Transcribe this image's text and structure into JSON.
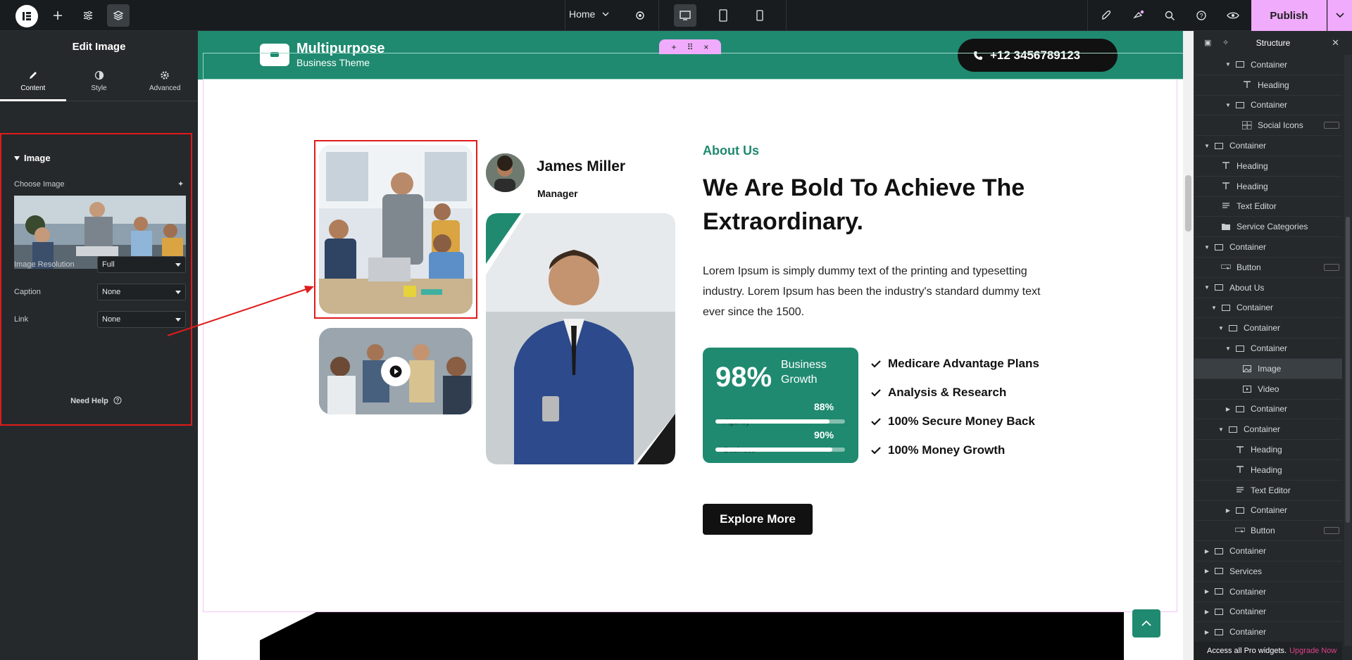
{
  "topbar": {
    "page_name": "Home",
    "publish_label": "Publish"
  },
  "left_panel": {
    "title": "Edit Image",
    "tabs": [
      {
        "label": "Content",
        "icon": "pencil-icon"
      },
      {
        "label": "Style",
        "icon": "contrast-icon"
      },
      {
        "label": "Advanced",
        "icon": "gear-icon"
      }
    ],
    "section_title": "Image",
    "choose_image_label": "Choose Image",
    "fields": [
      {
        "label": "Image Resolution",
        "value": "Full"
      },
      {
        "label": "Caption",
        "value": "None"
      },
      {
        "label": "Link",
        "value": "None"
      }
    ],
    "need_help": "Need Help"
  },
  "site": {
    "brand_name": "Multipurpose",
    "brand_tagline": "Business Theme",
    "phone": "+12 3456789123",
    "person_name": "James Miller",
    "person_role": "Manager",
    "about_eyebrow": "About Us",
    "about_title": "We Are Bold To Achieve The Extraordinary.",
    "about_body": "Lorem Ipsum is simply dummy text of the printing and typesetting industry. Lorem Ipsum has been the industry's standard dummy text ever since the 1500.",
    "stat_value": "98%",
    "stat_label": "Business Growth",
    "bars": [
      {
        "name": "Agency",
        "value": "88%",
        "fraction": 0.88
      },
      {
        "name": "Business",
        "value": "90%",
        "fraction": 0.9
      }
    ],
    "checklist": [
      "Medicare Advantage Plans",
      "Analysis & Research",
      "100% Secure Money Back",
      "100% Money Growth"
    ],
    "explore_label": "Explore More",
    "accent_color": "#1f8a70"
  },
  "structure": {
    "title": "Structure",
    "items": [
      {
        "label": "Container",
        "depth": 3,
        "caret": "down",
        "icon": "container-icon"
      },
      {
        "label": "Heading",
        "depth": 4,
        "caret": "",
        "icon": "heading-icon"
      },
      {
        "label": "Container",
        "depth": 3,
        "caret": "down",
        "icon": "container-icon"
      },
      {
        "label": "Social Icons",
        "depth": 4,
        "caret": "",
        "icon": "social-icons-icon"
      },
      {
        "label": "Container",
        "depth": 0,
        "caret": "down",
        "icon": "container-icon"
      },
      {
        "label": "Heading",
        "depth": 1,
        "caret": "",
        "icon": "heading-icon"
      },
      {
        "label": "Heading",
        "depth": 1,
        "caret": "",
        "icon": "heading-icon"
      },
      {
        "label": "Text Editor",
        "depth": 1,
        "caret": "",
        "icon": "text-editor-icon"
      },
      {
        "label": "Service Categories",
        "depth": 1,
        "caret": "",
        "icon": "folder-icon"
      },
      {
        "label": "Container",
        "depth": 0,
        "caret": "down",
        "icon": "container-icon"
      },
      {
        "label": "Button",
        "depth": 1,
        "caret": "",
        "icon": "button-icon"
      },
      {
        "label": "About Us",
        "depth": 0,
        "caret": "down",
        "icon": "container-icon"
      },
      {
        "label": "Container",
        "depth": 1,
        "caret": "down",
        "icon": "container-icon"
      },
      {
        "label": "Container",
        "depth": 2,
        "caret": "down",
        "icon": "container-icon"
      },
      {
        "label": "Container",
        "depth": 3,
        "caret": "down",
        "icon": "container-icon"
      },
      {
        "label": "Image",
        "depth": 4,
        "caret": "",
        "icon": "image-icon",
        "selected": true
      },
      {
        "label": "Video",
        "depth": 4,
        "caret": "",
        "icon": "video-icon"
      },
      {
        "label": "Container",
        "depth": 3,
        "caret": "right",
        "icon": "container-icon"
      },
      {
        "label": "Container",
        "depth": 2,
        "caret": "down",
        "icon": "container-icon"
      },
      {
        "label": "Heading",
        "depth": 3,
        "caret": "",
        "icon": "heading-icon"
      },
      {
        "label": "Heading",
        "depth": 3,
        "caret": "",
        "icon": "heading-icon"
      },
      {
        "label": "Text Editor",
        "depth": 3,
        "caret": "",
        "icon": "text-editor-icon"
      },
      {
        "label": "Container",
        "depth": 3,
        "caret": "right",
        "icon": "container-icon"
      },
      {
        "label": "Button",
        "depth": 3,
        "caret": "",
        "icon": "button-icon"
      },
      {
        "label": "Container",
        "depth": 0,
        "caret": "right",
        "icon": "container-icon"
      },
      {
        "label": "Services",
        "depth": 0,
        "caret": "right",
        "icon": "container-icon"
      },
      {
        "label": "Container",
        "depth": 0,
        "caret": "right",
        "icon": "container-icon"
      },
      {
        "label": "Container",
        "depth": 0,
        "caret": "right",
        "icon": "container-icon"
      },
      {
        "label": "Container",
        "depth": 0,
        "caret": "right",
        "icon": "container-icon"
      }
    ],
    "footer_text": "Access all Pro widgets.",
    "footer_link": "Upgrade Now"
  }
}
